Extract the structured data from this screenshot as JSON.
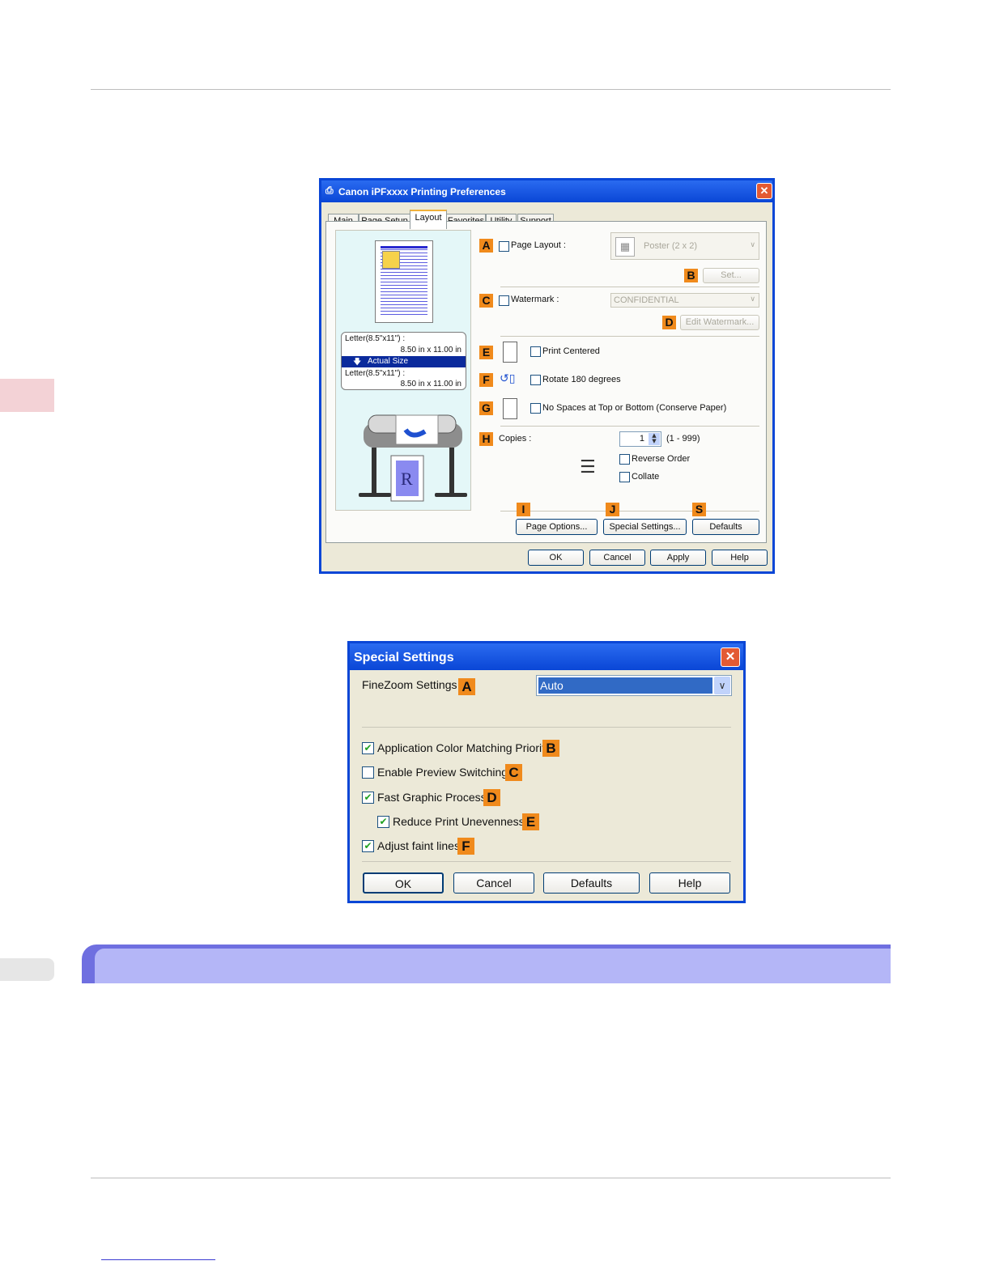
{
  "colors": {
    "accent_badge": "#f08a1c",
    "titlebar": "#0a46d6",
    "section_band": "#b4b6f7",
    "side_tab": "#f3d2d6"
  },
  "prefs_dialog": {
    "title": "Canon iPFxxxx Printing Preferences",
    "title_icon": "printer-icon",
    "tabs": [
      "Main",
      "Page Setup",
      "Layout",
      "Favorites",
      "Utility",
      "Support"
    ],
    "active_tab": "Layout",
    "preview": {
      "paper_line1": "Letter(8.5\"x11\") :",
      "paper_size1": "8.50 in x 11.00 in",
      "scaling": "Actual Size",
      "paper_line2": "Letter(8.5\"x11\") :",
      "paper_size2": "8.50 in x 11.00 in"
    },
    "badges": {
      "a": "A",
      "b": "B",
      "c": "C",
      "d": "D",
      "e": "E",
      "f": "F",
      "g": "G",
      "h": "H",
      "i": "I",
      "j": "J",
      "s": "S"
    },
    "page_layout_label": "Page Layout :",
    "page_layout_value": "Poster (2 x 2)",
    "set_button": "Set...",
    "watermark_label": "Watermark :",
    "watermark_value": "CONFIDENTIAL",
    "edit_watermark_button": "Edit Watermark...",
    "print_centered": "Print Centered",
    "rotate": "Rotate 180 degrees",
    "no_spaces": "No Spaces at Top or Bottom (Conserve Paper)",
    "copies_label": "Copies :",
    "copies_value": "1",
    "copies_range": "(1 - 999)",
    "reverse_order": "Reverse Order",
    "collate": "Collate",
    "page_options_button": "Page Options...",
    "special_settings_button": "Special Settings...",
    "defaults_button": "Defaults",
    "ok": "OK",
    "cancel": "Cancel",
    "apply": "Apply",
    "help": "Help"
  },
  "special_dialog": {
    "title": "Special Settings",
    "finezoom_label": "FineZoom Settings :",
    "finezoom_value": "Auto",
    "badges": {
      "a": "A",
      "b": "B",
      "c": "C",
      "d": "D",
      "e": "E",
      "f": "F"
    },
    "app_color": {
      "label": "Application Color Matching Priority",
      "checked": true
    },
    "preview_switch": {
      "label": "Enable Preview Switching",
      "checked": false
    },
    "fast_graphic": {
      "label": "Fast Graphic Process",
      "checked": true
    },
    "reduce_uneven": {
      "label": "Reduce Print Unevenness",
      "checked": true
    },
    "faint_lines": {
      "label": "Adjust faint lines",
      "checked": true
    },
    "ok": "OK",
    "cancel": "Cancel",
    "defaults": "Defaults",
    "help": "Help"
  }
}
